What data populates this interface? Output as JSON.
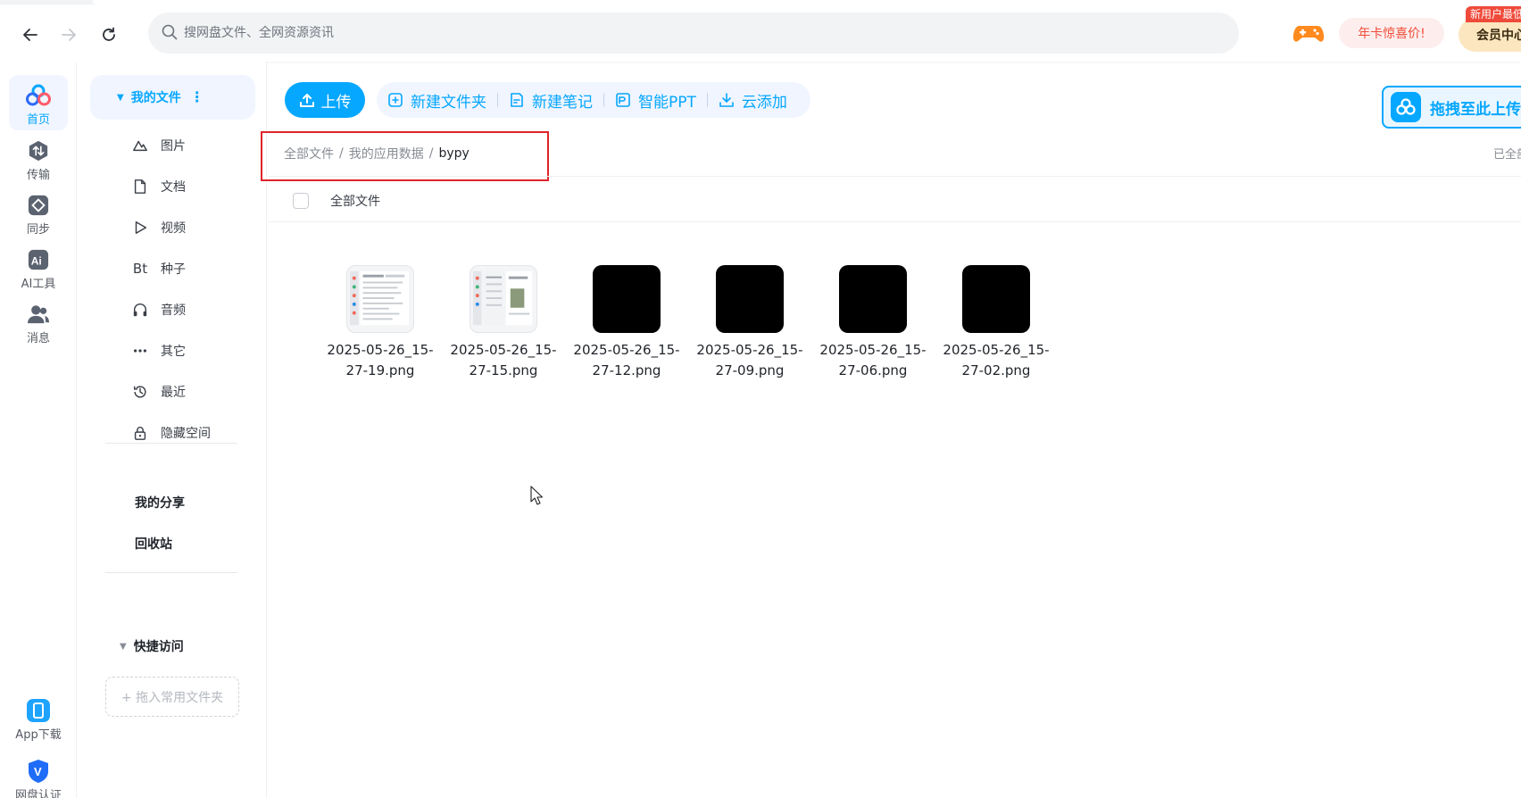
{
  "browser": {
    "search_placeholder": "搜网盘文件、全网资源资讯",
    "promo_label": "年卡惊喜价!",
    "vip_label": "会员中心",
    "vip_badge": "新用户最低"
  },
  "rail": {
    "items": [
      {
        "label": "首页"
      },
      {
        "label": "传输"
      },
      {
        "label": "同步"
      },
      {
        "label": "AI工具"
      },
      {
        "label": "消息"
      },
      {
        "label": "App下载"
      },
      {
        "label": "网盘认证"
      }
    ]
  },
  "sidebar": {
    "my_files": "我的文件",
    "categories": [
      {
        "label": "图片",
        "icon": "image-icon"
      },
      {
        "label": "文档",
        "icon": "document-icon"
      },
      {
        "label": "视频",
        "icon": "video-icon"
      },
      {
        "label": "种子",
        "icon": "bt-icon",
        "glyph": "Bt"
      },
      {
        "label": "音频",
        "icon": "headphones-icon"
      },
      {
        "label": "其它",
        "icon": "more-icon"
      },
      {
        "label": "最近",
        "icon": "recent-icon"
      },
      {
        "label": "隐藏空间",
        "icon": "lock-icon"
      }
    ],
    "my_share": "我的分享",
    "recycle": "回收站",
    "quick_access": "快捷访问",
    "dropzone": "+ 拖入常用文件夹"
  },
  "toolbar": {
    "upload": "上传",
    "new_folder": "新建文件夹",
    "new_note": "新建笔记",
    "smart_ppt": "智能PPT",
    "cloud_add": "云添加",
    "drag_upload": "拖拽至此上传"
  },
  "breadcrumb": {
    "items": [
      "全部文件",
      "我的应用数据",
      "bypy"
    ],
    "separator": "/"
  },
  "status": {
    "loaded": "已全部"
  },
  "list": {
    "header": "全部文件"
  },
  "files": [
    {
      "name": "2025-05-26_15-27-19.png",
      "thumb": "screenshot"
    },
    {
      "name": "2025-05-26_15-27-15.png",
      "thumb": "screenshot"
    },
    {
      "name": "2025-05-26_15-27-12.png",
      "thumb": "black"
    },
    {
      "name": "2025-05-26_15-27-09.png",
      "thumb": "black"
    },
    {
      "name": "2025-05-26_15-27-06.png",
      "thumb": "black"
    },
    {
      "name": "2025-05-26_15-27-02.png",
      "thumb": "black"
    }
  ],
  "colors": {
    "accent": "#06a7ff",
    "highlight_box": "#e0232a",
    "promo_text": "#f04d3a"
  }
}
